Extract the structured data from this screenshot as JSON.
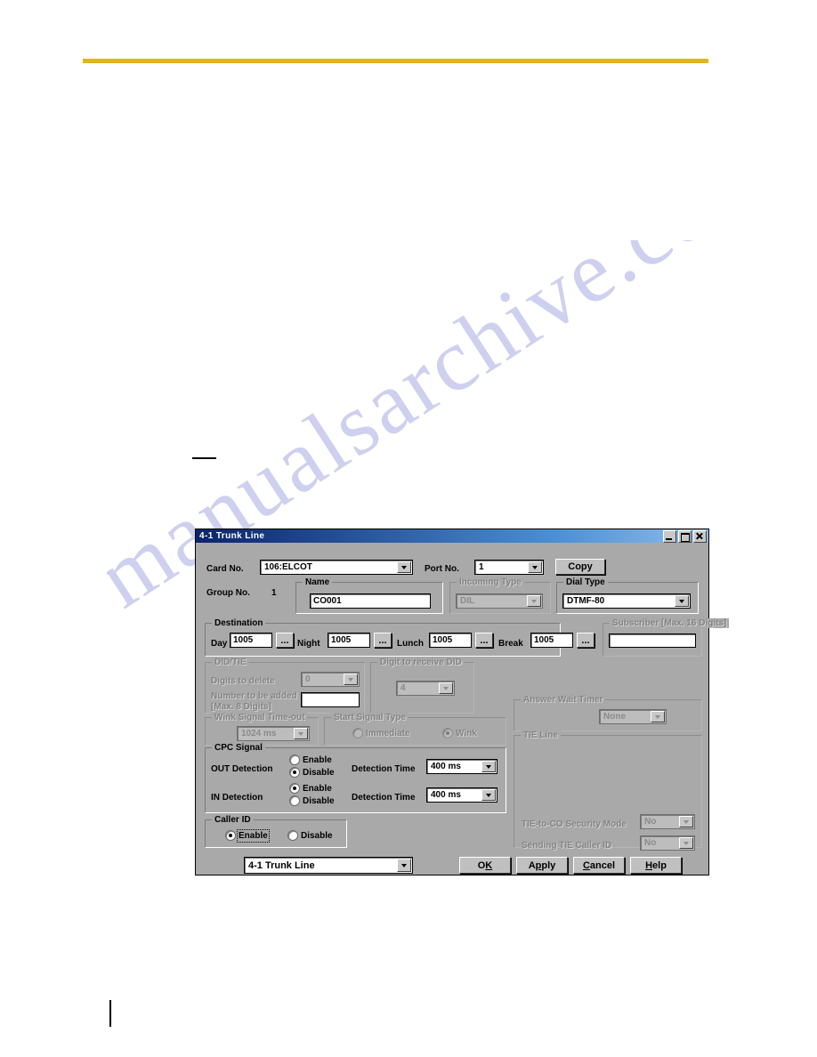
{
  "page": {
    "watermark_text": "manualsarchive.com"
  },
  "dialog": {
    "title": "4-1 Trunk Line",
    "window_buttons": {
      "minimize": "minimize-button",
      "maximize": "maximize-button",
      "close": "close-button"
    },
    "card_no": {
      "label": "Card No.",
      "value": "106:ELCOT"
    },
    "port_no": {
      "label": "Port No.",
      "value": "1"
    },
    "copy_button": "Copy",
    "group_no": {
      "label": "Group No.",
      "value": "1"
    },
    "name": {
      "label": "Name",
      "value": "CO001"
    },
    "incoming_type": {
      "label": "Incoming Type",
      "value": "DIL",
      "enabled": false
    },
    "dial_type": {
      "label": "Dial Type",
      "value": "DTMF-80",
      "enabled": true
    },
    "destination": {
      "label": "Destination",
      "fields": [
        {
          "label": "Day",
          "value": "1005",
          "browse": "..."
        },
        {
          "label": "Night",
          "value": "1005",
          "browse": "..."
        },
        {
          "label": "Lunch",
          "value": "1005",
          "browse": "..."
        },
        {
          "label": "Break",
          "value": "1005",
          "browse": "..."
        }
      ]
    },
    "subscriber": {
      "label": "Subscriber [Max. 16 Digits]",
      "value": "",
      "enabled": false
    },
    "did_tie": {
      "label": "DID/TIE",
      "digits_to_delete": {
        "label": "Digits to delete",
        "value": "0"
      },
      "number_to_be_added": {
        "label": "Number to be added",
        "sublabel": "[Max. 8 Digits]",
        "value": ""
      }
    },
    "digit_to_receive_did": {
      "label": "Digit to receive DID",
      "value": "4"
    },
    "wink_signal_timeout": {
      "label": "Wink Signal Time-out",
      "value": "1024 ms"
    },
    "start_signal_type": {
      "label": "Start Signal Type",
      "options": [
        {
          "label": "Immediate",
          "selected": false
        },
        {
          "label": "Wink",
          "selected": true
        }
      ]
    },
    "answer_wait_timer": {
      "label": "Answer Wait Timer",
      "value": "None"
    },
    "cpc_signal": {
      "label": "CPC Signal",
      "out_detection": {
        "label": "OUT Detection",
        "options": [
          {
            "label": "Enable",
            "selected": false
          },
          {
            "label": "Disable",
            "selected": true
          }
        ],
        "detection_time_label": "Detection Time",
        "detection_time_value": "400 ms"
      },
      "in_detection": {
        "label": "IN Detection",
        "options": [
          {
            "label": "Enable",
            "selected": true
          },
          {
            "label": "Disable",
            "selected": false
          }
        ],
        "detection_time_label": "Detection Time",
        "detection_time_value": "400 ms"
      }
    },
    "caller_id": {
      "label": "Caller ID",
      "options": [
        {
          "label": "Enable",
          "selected": true
        },
        {
          "label": "Disable",
          "selected": false
        }
      ]
    },
    "tie_line": {
      "label": "TIE Line",
      "tie_to_co_security_mode": {
        "label": "TIE-to-CO Security Mode",
        "value": "No"
      },
      "sending_tie_caller_id": {
        "label": "Sending TIE Caller ID",
        "value": "No"
      }
    },
    "screen_selector": {
      "value": "4-1 Trunk Line"
    },
    "buttons": {
      "ok": {
        "pre": "O",
        "accel": "K",
        "post": ""
      },
      "apply": {
        "pre": "A",
        "accel": "p",
        "post": "ply"
      },
      "cancel": {
        "pre": "",
        "accel": "C",
        "post": "ancel"
      },
      "help": {
        "pre": "",
        "accel": "H",
        "post": "elp"
      }
    }
  }
}
